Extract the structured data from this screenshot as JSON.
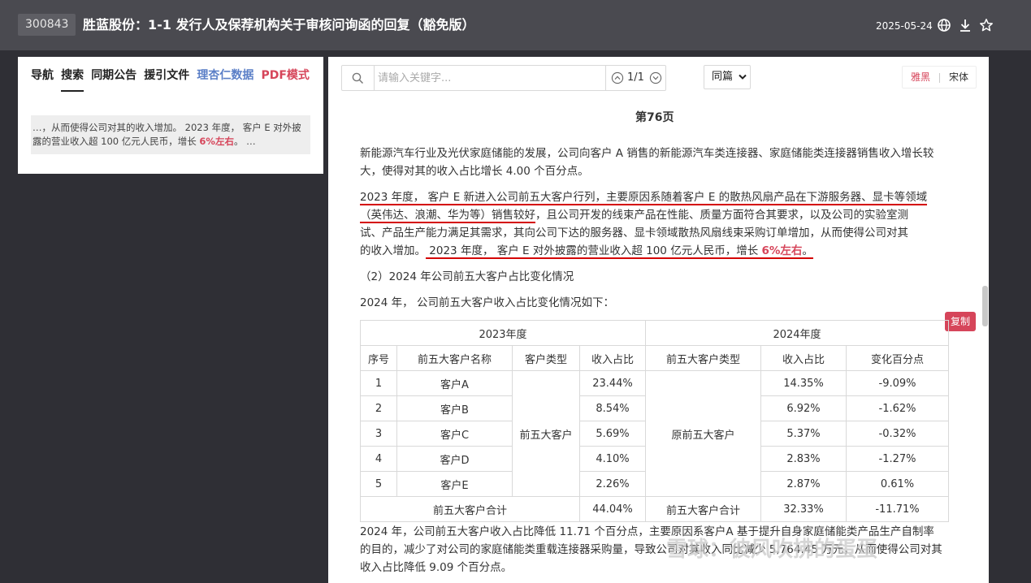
{
  "header": {
    "stock_code": "300843",
    "title": "胜蓝股份：1-1 发行人及保荐机构关于审核问询函的回复（豁免版）",
    "date": "2025-05-24"
  },
  "left": {
    "tabs": [
      {
        "label": "导航"
      },
      {
        "label": "搜索"
      },
      {
        "label": "同期公告"
      },
      {
        "label": "援引文件"
      },
      {
        "label": "理杏仁数据"
      },
      {
        "label": "PDF模式"
      }
    ],
    "result": {
      "text_a": "…，从而使得公司对其的收入增加。 2023 年度， 客户 E 对外披露的营业收入超 100 亿元人民币，增长 ",
      "highlight": "6%左右",
      "text_b": "。 …"
    }
  },
  "toolbar": {
    "search_placeholder": "请输入关键字...",
    "match_count": "1/1",
    "scope_select": "同篇",
    "font_a": "雅黑",
    "font_b": "宋体",
    "copy_label": "复制"
  },
  "doc": {
    "page_label": "第76页",
    "para1": "新能源汽车行业及光伏家庭储能的发展，公司向客户 A 销售的新能源汽车类连接器、家庭储能类连接器销售收入增长较大，使得对其的收入占比增长 4.00 个百分点。",
    "para2_l1": "2023 年度， 客户 E 新进入公司前五大客户行列，主要原因系随着客户 E 的散热风扇产品在下游服务器、显卡等领域",
    "para2_l2a": "（英伟达、浪潮、华为等）销售较好",
    "para2_l2b": "，且公司开发的线束产品在性能、质量方面符合其要求，以及公司的实验室测",
    "para2_l3": "试、产品生产能力满足其需求，其向公司下达的服务器、显卡领域散热风扇线束采购订单增加，从而使得公司对其",
    "para2_l4a": "的收入增加。",
    "para2_l4b": " 2023 年度， 客户 E 对外披露的营业收入超 100 亿元人民币，增长 ",
    "para2_hl": "6%左右",
    "para2_end": "。",
    "section": "（2）2024 年公司前五大客户占比变化情况",
    "intro": "2024 年， 公司前五大客户收入占比变化情况如下：",
    "table": {
      "group_2023": "2023年度",
      "group_2024": "2024年度",
      "headers": [
        "序号",
        "前五大客户名称",
        "客户类型",
        "收入占比",
        "前五大客户类型",
        "收入占比",
        "变化百分点"
      ],
      "type_2023": "前五大客户",
      "type_2024": "原前五大客户",
      "rows": [
        {
          "no": "1",
          "name": "客户A",
          "share23": "23.44%",
          "share24": "14.35%",
          "chg": "-9.09%"
        },
        {
          "no": "2",
          "name": "客户B",
          "share23": "8.54%",
          "share24": "6.92%",
          "chg": "-1.62%"
        },
        {
          "no": "3",
          "name": "客户C",
          "share23": "5.69%",
          "share24": "5.37%",
          "chg": "-0.32%"
        },
        {
          "no": "4",
          "name": "客户D",
          "share23": "4.10%",
          "share24": "2.83%",
          "chg": "-1.27%"
        },
        {
          "no": "5",
          "name": "客户E",
          "share23": "2.26%",
          "share24": "2.87%",
          "chg": "0.61%"
        }
      ],
      "total_label_23": "前五大客户合计",
      "total_23": "44.04%",
      "total_label_24": "前五大客户合计",
      "total_24": "32.33%",
      "total_chg": "-11.71%"
    },
    "para3_l1": "2024 年，公司前五大客户收入占比降低 11.71 个百分点，主要原因系客户A 基于提升自身家庭储能类产品生产自制率",
    "para3_l2": "的目的，减少了对公司的家庭储能类重载连接器采购量，导致公司对其收入同比减少 5,764.45 万元，从而使得公司对其",
    "para3_l3": "收入占比降低 9.09 个百分点。"
  },
  "watermark": "雪球：彼风吹拂的蛋蛋"
}
